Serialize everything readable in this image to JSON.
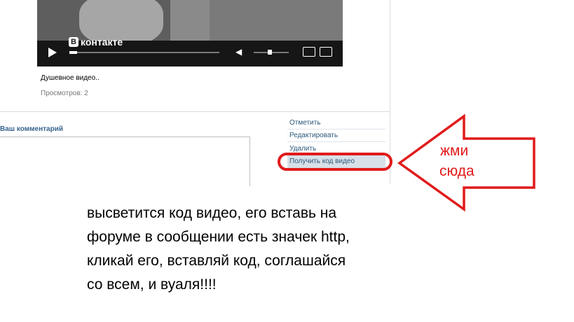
{
  "player": {
    "logo_letter": "В",
    "logo_text": "контакте",
    "progress_fraction": 0.05,
    "volume_fraction": 0.45
  },
  "video": {
    "title": "Душевное видео..",
    "views": "Просмотров: 2"
  },
  "comment": {
    "header": "Ваш комментарий"
  },
  "menu": {
    "items": [
      "Отметить",
      "Редактировать",
      "Удалить",
      "Получить код видео"
    ]
  },
  "annotation": {
    "arrow_line1": "жми",
    "arrow_line2": "сюда",
    "instruction_lines": [
      "высветится код видео, его вставь на",
      "форуме в сообщении есть значек http,",
      "кликай его, вставляй код, соглашайся",
      "со всем, и вуаля!!!!"
    ],
    "color": "#e11b1b"
  }
}
